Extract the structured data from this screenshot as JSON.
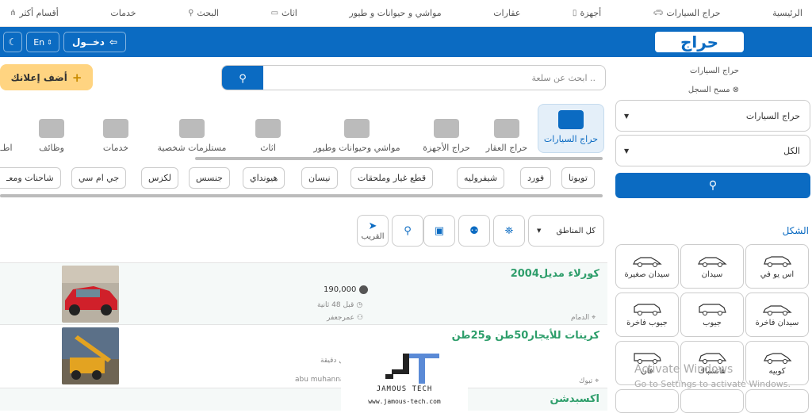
{
  "nav": {
    "items": [
      "الرئيسية",
      "حراج السيارات",
      "أجهزة",
      "عقارات",
      "مواشي و حيوانات و طيور",
      "اثاث",
      "البحث",
      "خدمات",
      "أقسام أكثر"
    ]
  },
  "header": {
    "logo": "حراج",
    "login": "دخــول",
    "lang": "En"
  },
  "sidebar": {
    "breadcrumb": "حراج السيارات",
    "clear": "مسح السجل",
    "select1": "حراج السيارات",
    "select2": "الكل",
    "shape_title": "الشكل",
    "tiles": [
      "اس يو في",
      "سيدان",
      "سيدان صغيرة",
      "سيدان فاخرة",
      "جيوب",
      "جيوب فاخرة",
      "كوبيه",
      "هاتشباك",
      "فان"
    ]
  },
  "search": {
    "placeholder": "ابحث عن سلعة .."
  },
  "add_ad": "أضف إعلانك",
  "categories": [
    "حراج السيارات",
    "حراج العقار",
    "حراج الأجهزة",
    "مواشي وحيوانات وطيور",
    "اثاث",
    "مستلزمات شخصية",
    "خدمات",
    "وظائف",
    "اطـ"
  ],
  "brands": [
    "تويوتا",
    "فورد",
    "شيفروليه",
    "قطع غيار وملحقات",
    "نيسان",
    "هيونداي",
    "جنسس",
    "لكزس",
    "جي ام سي",
    "شاحنات ومعـ"
  ],
  "filters": {
    "region": "كل المناطق",
    "near": "القريب"
  },
  "listings": [
    {
      "title": "كورلاء مديل2004",
      "price": "190,000",
      "time": "قبل 48 ثانية",
      "user": "عمرجعفر",
      "city": "الدمام"
    },
    {
      "title": "كرينات للأيجار50طن و25طن",
      "time": "قبل دقيقة",
      "user": "abu muhannad 2",
      "city": "تبوك"
    },
    {
      "title": "اكسبدشن"
    }
  ],
  "watermark": {
    "t1": "JAMOUS TECH",
    "t2": "www.jamous-tech.com"
  },
  "activate": {
    "l1": "Activate Windows",
    "l2": "Go to Settings to activate Windows."
  }
}
